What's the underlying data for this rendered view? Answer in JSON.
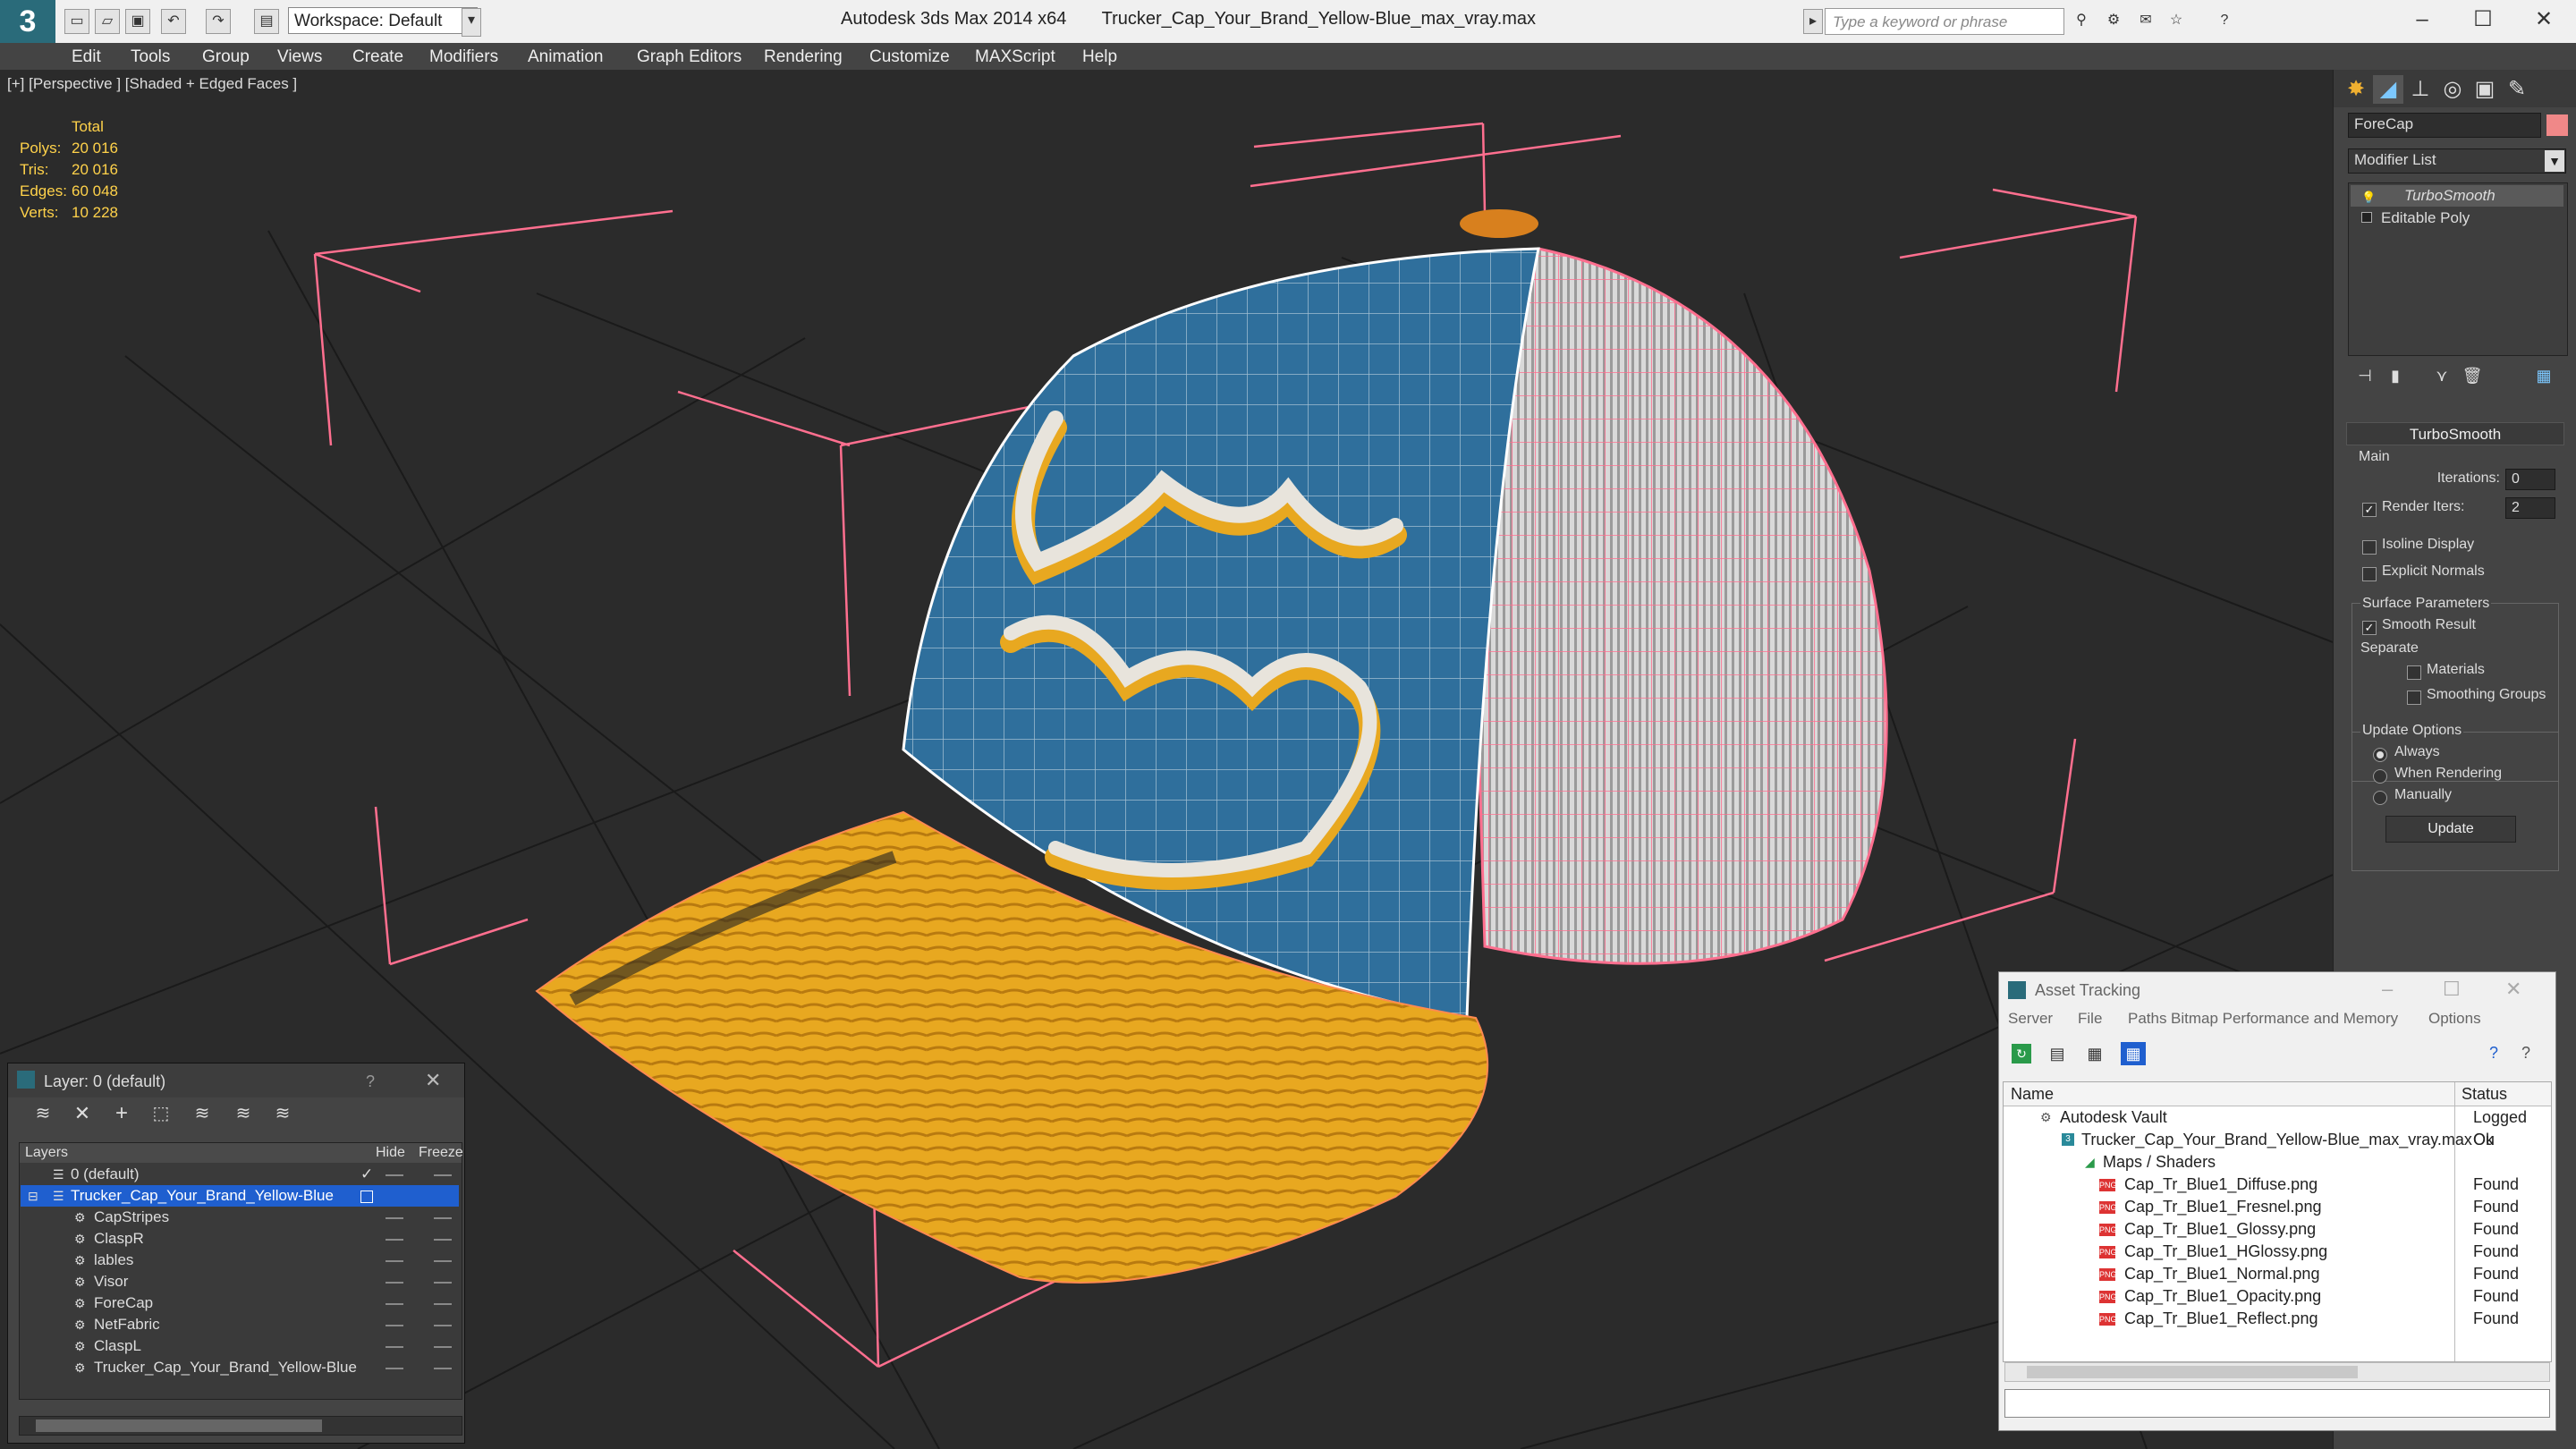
{
  "titlebar": {
    "app": "Autodesk 3ds Max  2014 x64",
    "file": "Trucker_Cap_Your_Brand_Yellow-Blue_max_vray.max",
    "workspace": "Workspace: Default",
    "search_placeholder": "Type a keyword or phrase"
  },
  "menu": [
    "Edit",
    "Tools",
    "Group",
    "Views",
    "Create",
    "Modifiers",
    "Animation",
    "Graph Editors",
    "Rendering",
    "Customize",
    "MAXScript",
    "Help"
  ],
  "viewport": {
    "label": "[+] [Perspective ] [Shaded + Edged Faces ]",
    "stats": {
      "total_label": "Total",
      "rows": [
        {
          "label": "Polys:",
          "value": "20 016"
        },
        {
          "label": "Tris:",
          "value": "20 016"
        },
        {
          "label": "Edges:",
          "value": "60 048"
        },
        {
          "label": "Verts:",
          "value": "10 228"
        }
      ]
    }
  },
  "command_panel": {
    "object_name": "ForeCap",
    "modifier_list": "Modifier List",
    "stack": [
      "TurboSmooth",
      "Editable Poly"
    ],
    "rollout": "TurboSmooth",
    "main": "Main",
    "iterations_label": "Iterations:",
    "iterations": "0",
    "render_iters_label": "Render Iters:",
    "render_iters": "2",
    "isoline": "Isoline Display",
    "explicit_normals": "Explicit Normals",
    "surface_params": "Surface Parameters",
    "smooth_result": "Smooth Result",
    "separate": "Separate",
    "materials": "Materials",
    "smoothing_groups": "Smoothing Groups",
    "update_options": "Update Options",
    "always": "Always",
    "when_rendering": "When Rendering",
    "manually": "Manually",
    "update_button": "Update"
  },
  "layer_dialog": {
    "title": "Layer: 0 (default)",
    "help": "?",
    "columns": [
      "Layers",
      "Hide",
      "Freeze"
    ],
    "rows": [
      {
        "name": "0 (default)",
        "indent": 1,
        "selected": false
      },
      {
        "name": "Trucker_Cap_Your_Brand_Yellow-Blue",
        "indent": 1,
        "selected": true
      },
      {
        "name": "CapStripes",
        "indent": 2,
        "selected": false
      },
      {
        "name": "ClaspR",
        "indent": 2,
        "selected": false
      },
      {
        "name": "lables",
        "indent": 2,
        "selected": false
      },
      {
        "name": "Visor",
        "indent": 2,
        "selected": false
      },
      {
        "name": "ForeCap",
        "indent": 2,
        "selected": false
      },
      {
        "name": "NetFabric",
        "indent": 2,
        "selected": false
      },
      {
        "name": "ClaspL",
        "indent": 2,
        "selected": false
      },
      {
        "name": "Trucker_Cap_Your_Brand_Yellow-Blue",
        "indent": 2,
        "selected": false
      }
    ]
  },
  "asset_dialog": {
    "title": "Asset Tracking",
    "menu": [
      "Server",
      "File",
      "Paths",
      "Bitmap Performance and Memory",
      "Options"
    ],
    "columns": [
      "Name",
      "Status"
    ],
    "rows": [
      {
        "name": "Autodesk Vault",
        "status": "Logged Ou",
        "indent": 0
      },
      {
        "name": "Trucker_Cap_Your_Brand_Yellow-Blue_max_vray.max",
        "status": "Ok",
        "indent": 1
      },
      {
        "name": "Maps / Shaders",
        "status": "",
        "indent": 2
      },
      {
        "name": "Cap_Tr_Blue1_Diffuse.png",
        "status": "Found",
        "indent": 3
      },
      {
        "name": "Cap_Tr_Blue1_Fresnel.png",
        "status": "Found",
        "indent": 3
      },
      {
        "name": "Cap_Tr_Blue1_Glossy.png",
        "status": "Found",
        "indent": 3
      },
      {
        "name": "Cap_Tr_Blue1_HGlossy.png",
        "status": "Found",
        "indent": 3
      },
      {
        "name": "Cap_Tr_Blue1_Normal.png",
        "status": "Found",
        "indent": 3
      },
      {
        "name": "Cap_Tr_Blue1_Opacity.png",
        "status": "Found",
        "indent": 3
      },
      {
        "name": "Cap_Tr_Blue1_Reflect.png",
        "status": "Found",
        "indent": 3
      }
    ]
  },
  "colors": {
    "cap_blue": "#2f6f9c",
    "visor_yellow": "#e8a820",
    "mesh_pink": "#ff6f8f",
    "selection": "#1f5fcf"
  }
}
